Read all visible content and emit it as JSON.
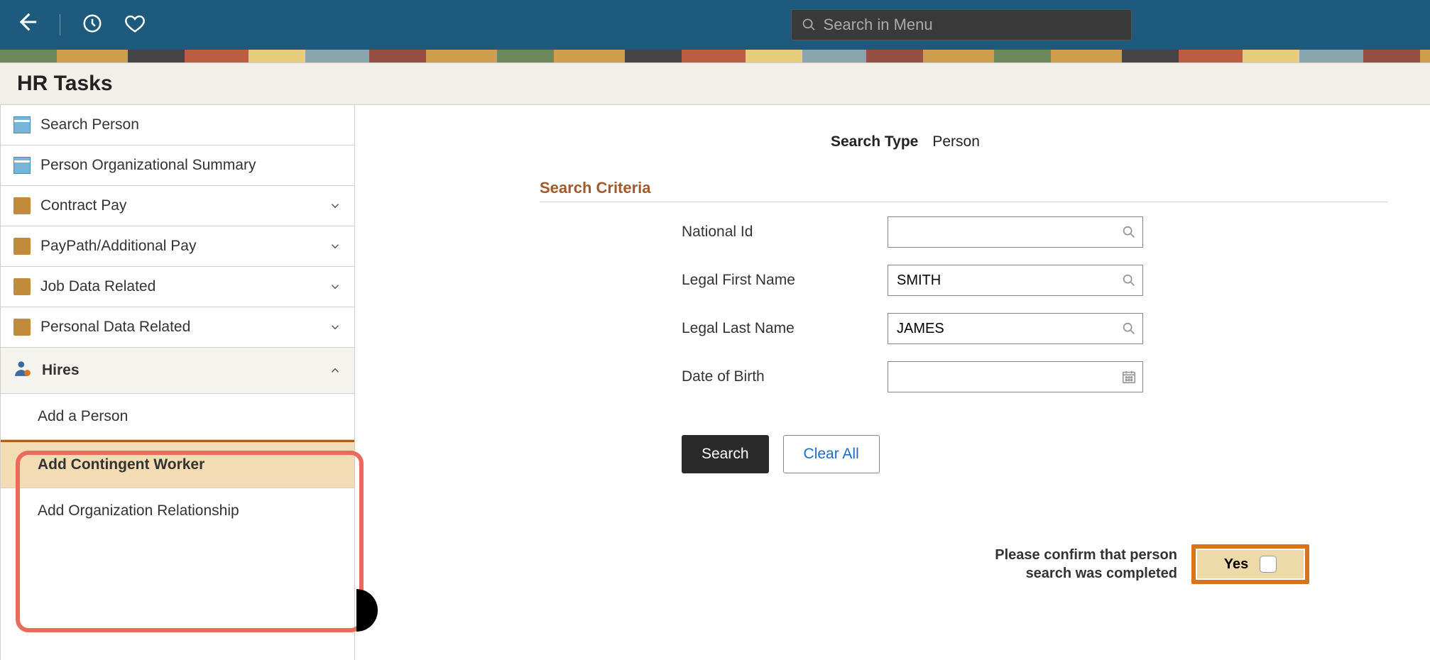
{
  "header": {
    "search_placeholder": "Search in Menu"
  },
  "page_title": "HR Tasks",
  "sidebar": {
    "items": [
      {
        "label": "Search Person",
        "icon": "page"
      },
      {
        "label": "Person Organizational Summary",
        "icon": "page"
      },
      {
        "label": "Contract Pay",
        "icon": "folder",
        "expandable": true
      },
      {
        "label": "PayPath/Additional Pay",
        "icon": "folder",
        "expandable": true
      },
      {
        "label": "Job Data Related",
        "icon": "folder",
        "expandable": true
      },
      {
        "label": "Personal Data Related",
        "icon": "folder",
        "expandable": true
      },
      {
        "label": "Hires",
        "icon": "person",
        "expandable": true,
        "expanded": true,
        "children": [
          {
            "label": "Add a Person"
          },
          {
            "label": "Add Contingent Worker",
            "active": true
          },
          {
            "label": "Add Organization Relationship"
          }
        ]
      }
    ]
  },
  "content": {
    "search_type_label": "Search Type",
    "search_type_value": "Person",
    "section_heading": "Search Criteria",
    "fields": {
      "national_id": {
        "label": "National Id",
        "value": ""
      },
      "first_name": {
        "label": "Legal First Name",
        "value": "SMITH"
      },
      "last_name": {
        "label": "Legal Last Name",
        "value": "JAMES"
      },
      "dob": {
        "label": "Date of Birth",
        "value": ""
      }
    },
    "buttons": {
      "search": "Search",
      "clear": "Clear All"
    },
    "confirm": {
      "line1": "Please confirm that person",
      "line2": "search was completed",
      "toggle_label": "Yes"
    }
  }
}
